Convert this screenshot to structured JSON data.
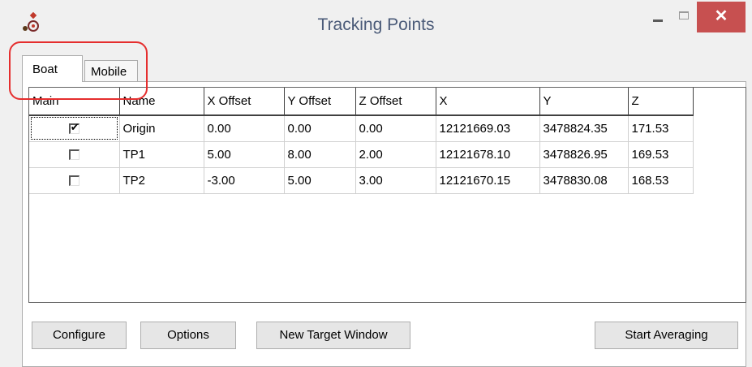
{
  "window": {
    "title": "Tracking Points",
    "close_glyph": "✕"
  },
  "tabs": [
    {
      "label": "Boat",
      "active": true
    },
    {
      "label": "Mobile",
      "active": false
    }
  ],
  "grid": {
    "columns": [
      "Main",
      "Name",
      "X Offset",
      "Y Offset",
      "Z Offset",
      "X",
      "Y",
      "Z"
    ],
    "rows": [
      {
        "main": true,
        "name": "Origin",
        "x_offset": "0.00",
        "y_offset": "0.00",
        "z_offset": "0.00",
        "x": "12121669.03",
        "y": "3478824.35",
        "z": "171.53"
      },
      {
        "main": false,
        "name": "TP1",
        "x_offset": "5.00",
        "y_offset": "8.00",
        "z_offset": "2.00",
        "x": "12121678.10",
        "y": "3478826.95",
        "z": "169.53"
      },
      {
        "main": false,
        "name": "TP2",
        "x_offset": "-3.00",
        "y_offset": "5.00",
        "z_offset": "3.00",
        "x": "12121670.15",
        "y": "3478830.08",
        "z": "168.53"
      }
    ]
  },
  "buttons": {
    "configure": "Configure",
    "options": "Options",
    "new_target_window": "New Target Window",
    "start_averaging": "Start Averaging"
  },
  "colors": {
    "close_button": "#c75050",
    "highlight": "#e52e2e",
    "title_text": "#4a5a78"
  },
  "icons": {
    "app": "app-icon",
    "minimize": "minimize-icon",
    "maximize": "maximize-icon",
    "close": "close-icon",
    "checkbox": "checkbox-icon"
  }
}
